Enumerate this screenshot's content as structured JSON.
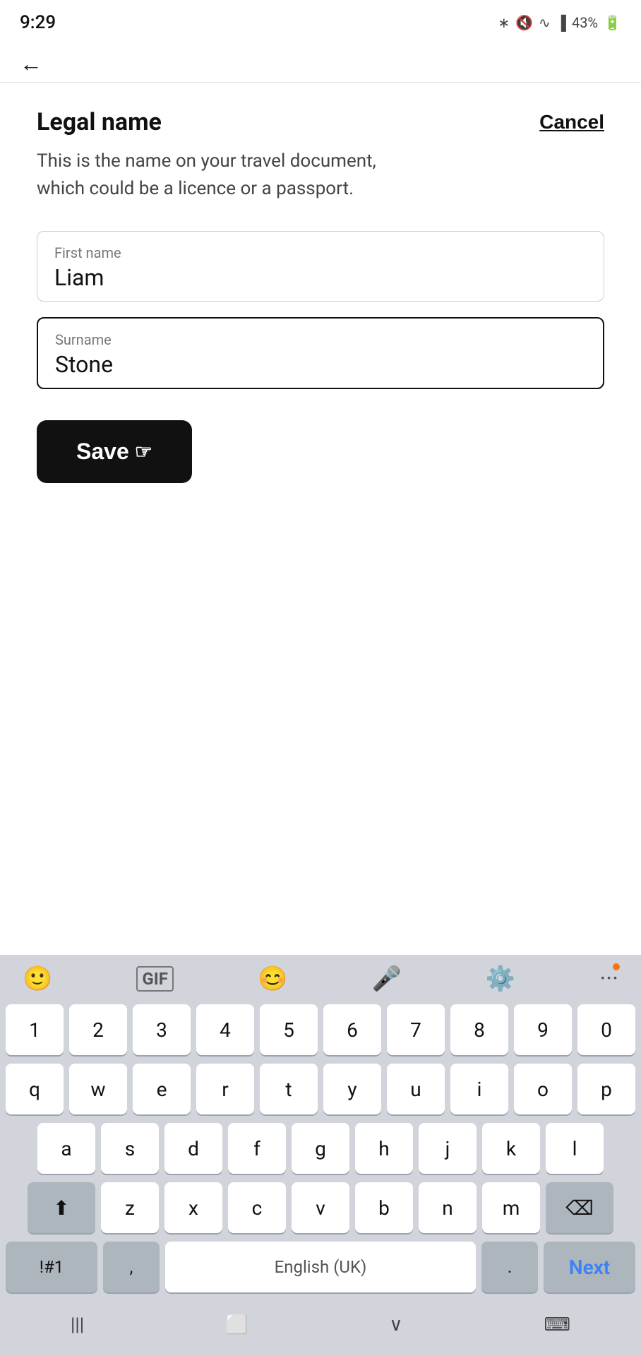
{
  "statusBar": {
    "time": "9:29",
    "battery": "43%"
  },
  "nav": {
    "backArrow": "←"
  },
  "page": {
    "title": "Legal name",
    "description": "This is the name on your travel document, which could be a licence or a passport.",
    "cancelLabel": "Cancel"
  },
  "form": {
    "firstNameLabel": "First name",
    "firstNameValue": "Liam",
    "surnameLabel": "Surname",
    "surnameValue": "Stone"
  },
  "saveButton": {
    "label": "Save"
  },
  "keyboard": {
    "row1": [
      "1",
      "2",
      "3",
      "4",
      "5",
      "6",
      "7",
      "8",
      "9",
      "0"
    ],
    "row2": [
      "q",
      "w",
      "e",
      "r",
      "t",
      "y",
      "u",
      "i",
      "o",
      "p"
    ],
    "row3": [
      "a",
      "s",
      "d",
      "f",
      "g",
      "h",
      "j",
      "k",
      "l"
    ],
    "row4": [
      "z",
      "x",
      "c",
      "v",
      "b",
      "n",
      "m"
    ],
    "symLabel": "!#1",
    "commaLabel": ",",
    "spaceLabel": "English (UK)",
    "periodLabel": ".",
    "nextLabel": "Next"
  }
}
